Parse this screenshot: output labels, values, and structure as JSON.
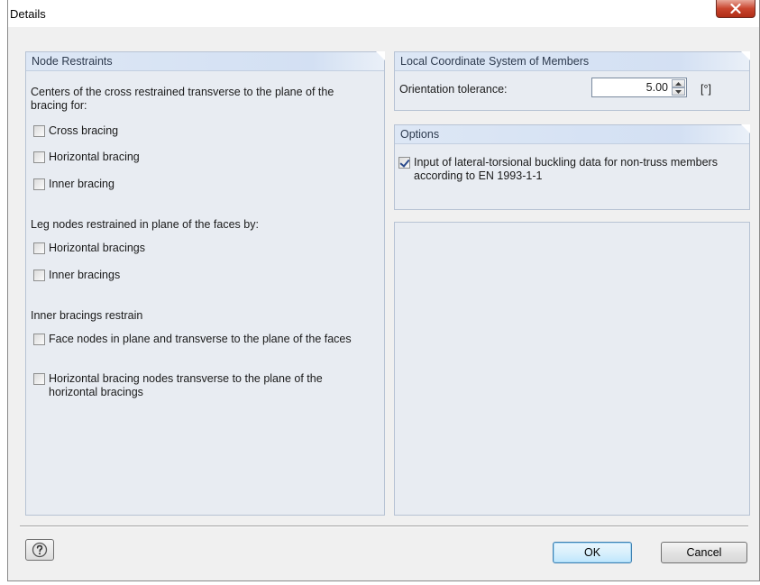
{
  "window": {
    "title": "Details"
  },
  "node_restraints": {
    "header": "Node Restraints",
    "centers_text": "Centers of the cross restrained transverse to the plane of the bracing for:",
    "centers_options": [
      {
        "label": "Cross bracing",
        "checked": false
      },
      {
        "label": "Horizontal bracing",
        "checked": false
      },
      {
        "label": "Inner bracing",
        "checked": false
      }
    ],
    "leg_text": "Leg nodes restrained in plane of the faces by:",
    "leg_options": [
      {
        "label": "Horizontal bracings",
        "checked": false
      },
      {
        "label": "Inner bracings",
        "checked": false
      }
    ],
    "inner_text": "Inner bracings restrain",
    "inner_options": [
      {
        "label": "Face nodes in plane and transverse to the plane of the faces",
        "checked": false
      },
      {
        "label": "Horizontal bracing nodes transverse to the plane of the horizontal bracings",
        "checked": false
      }
    ]
  },
  "local_coordinate_system": {
    "header": "Local Coordinate System of Members",
    "orientation_label": "Orientation tolerance:",
    "orientation_value": "5.00",
    "orientation_unit": "[°]"
  },
  "options": {
    "header": "Options",
    "lateral_torsional": {
      "label": "Input of lateral-torsional buckling data for non-truss members according to EN 1993-1-1",
      "checked": true
    }
  },
  "footer": {
    "ok_label": "OK",
    "cancel_label": "Cancel"
  },
  "colors": {
    "panel_bg": "#e8ecf2",
    "panel_header": "#d3e0f3",
    "close_button": "#c9452e",
    "ok_border": "#3c7fb1"
  }
}
